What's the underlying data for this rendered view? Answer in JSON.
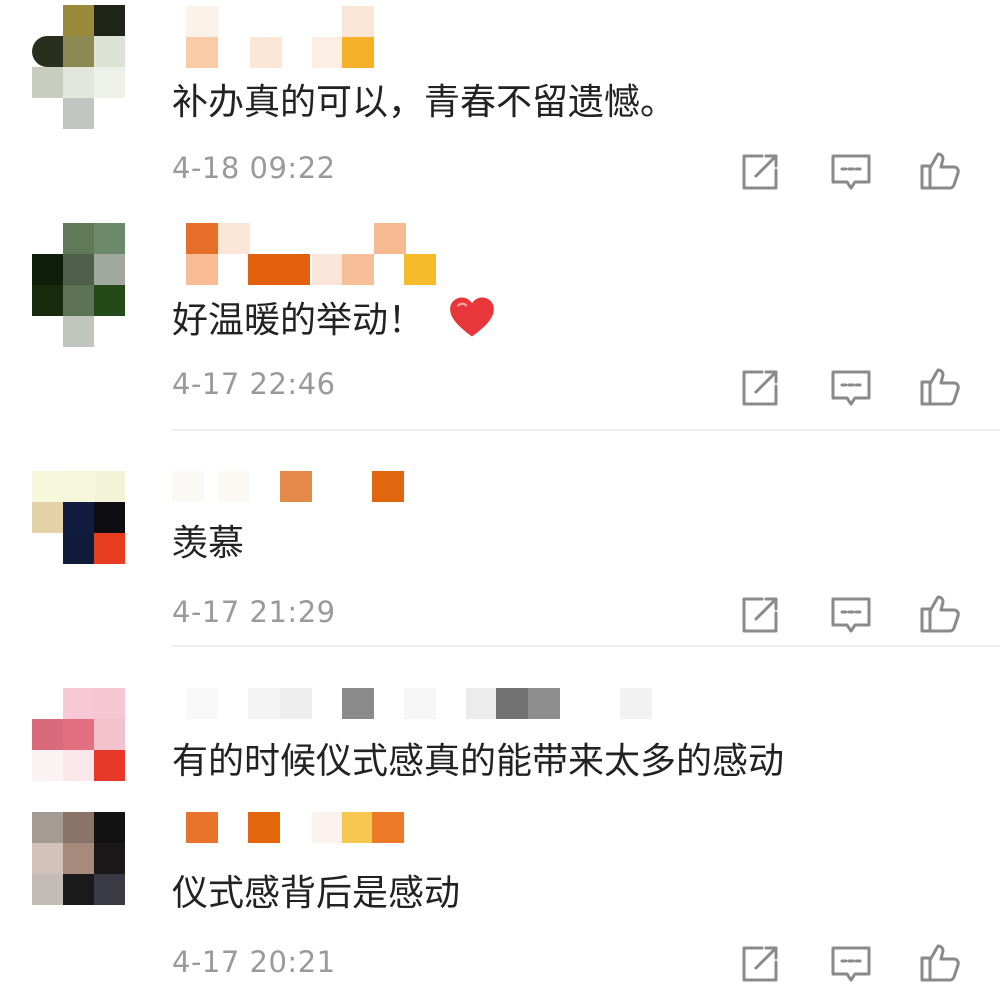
{
  "colors": {
    "text": "#222222",
    "meta": "#9a9a9a",
    "icon": "#8a8a8a",
    "divider": "#ededed",
    "heart": "#e8363a"
  },
  "icons": {
    "forward": "share-edit-icon",
    "reply": "comment-bubble-icon",
    "like": "thumbs-up-icon",
    "emoji": "red-heart-emoji"
  },
  "comments": [
    {
      "text": "补办真的可以，青春不留遗憾。",
      "time": "4-18 09:22"
    },
    {
      "text": "好温暖的举动！",
      "time": "4-17 22:46"
    },
    {
      "text": "羡慕",
      "time": "4-17 21:29"
    },
    {
      "text": "有的时候仪式感真的能带来太多的感动",
      "time": ""
    },
    {
      "text": "仪式感背后是感动",
      "time": "4-17 20:21"
    }
  ]
}
